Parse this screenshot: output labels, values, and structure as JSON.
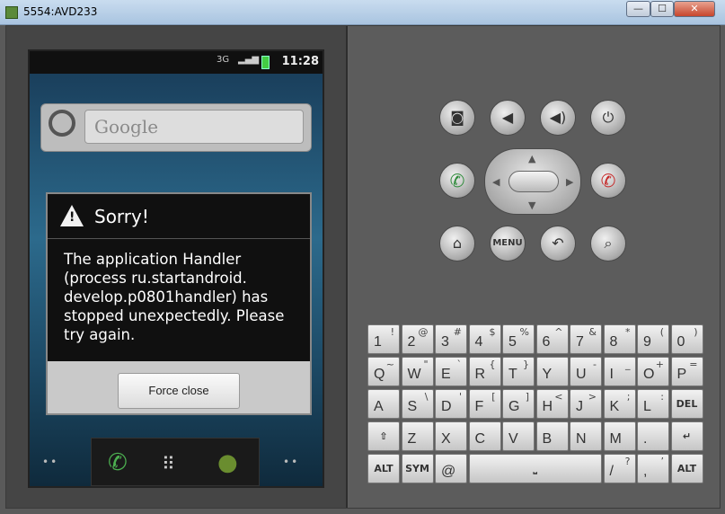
{
  "window": {
    "title": "5554:AVD233",
    "min_label": "—",
    "max_label": "☐",
    "close_label": "✕"
  },
  "statusbar": {
    "time": "11:28",
    "network": "3G"
  },
  "home": {
    "search_placeholder": "Google"
  },
  "dialog": {
    "title": "Sorry!",
    "message": "The application Handler (process ru.startandroid. develop.p0801handler) has stopped unexpectedly. Please try again.",
    "button": "Force close"
  },
  "hardware": {
    "menu_label": "MENU"
  },
  "keyboard": {
    "rows": [
      [
        [
          "1",
          "!"
        ],
        [
          "2",
          "@"
        ],
        [
          "3",
          "#"
        ],
        [
          "4",
          "$"
        ],
        [
          "5",
          "%"
        ],
        [
          "6",
          "^"
        ],
        [
          "7",
          "&"
        ],
        [
          "8",
          "*"
        ],
        [
          "9",
          "("
        ],
        [
          "0",
          ")"
        ]
      ],
      [
        [
          "Q",
          "~"
        ],
        [
          "W",
          "\""
        ],
        [
          "E",
          "`"
        ],
        [
          "R",
          "{"
        ],
        [
          "T",
          "}"
        ],
        [
          "Y",
          ""
        ],
        [
          "U",
          "-"
        ],
        [
          "I",
          "_"
        ],
        [
          "O",
          "+"
        ],
        [
          "P",
          "="
        ]
      ],
      [
        [
          "A",
          ""
        ],
        [
          "S",
          "\\"
        ],
        [
          "D",
          "'"
        ],
        [
          "F",
          "["
        ],
        [
          "G",
          "]"
        ],
        [
          "H",
          "<"
        ],
        [
          "J",
          ">"
        ],
        [
          "K",
          ";"
        ],
        [
          "L",
          ":"
        ]
      ],
      [
        [
          "Z",
          ""
        ],
        [
          "X",
          ""
        ],
        [
          "C",
          ""
        ],
        [
          "V",
          ""
        ],
        [
          "B",
          ""
        ],
        [
          "N",
          ""
        ],
        [
          "M",
          ""
        ],
        [
          ".",
          ""
        ]
      ]
    ],
    "del_label": "DEL",
    "alt_label": "ALT",
    "sym_label": "SYM",
    "at_label": "@",
    "slash_label": "/",
    "slash_alt": "?",
    "comma_label": ",",
    "comma_alt": "’",
    "alt_right_label": "ALT"
  }
}
